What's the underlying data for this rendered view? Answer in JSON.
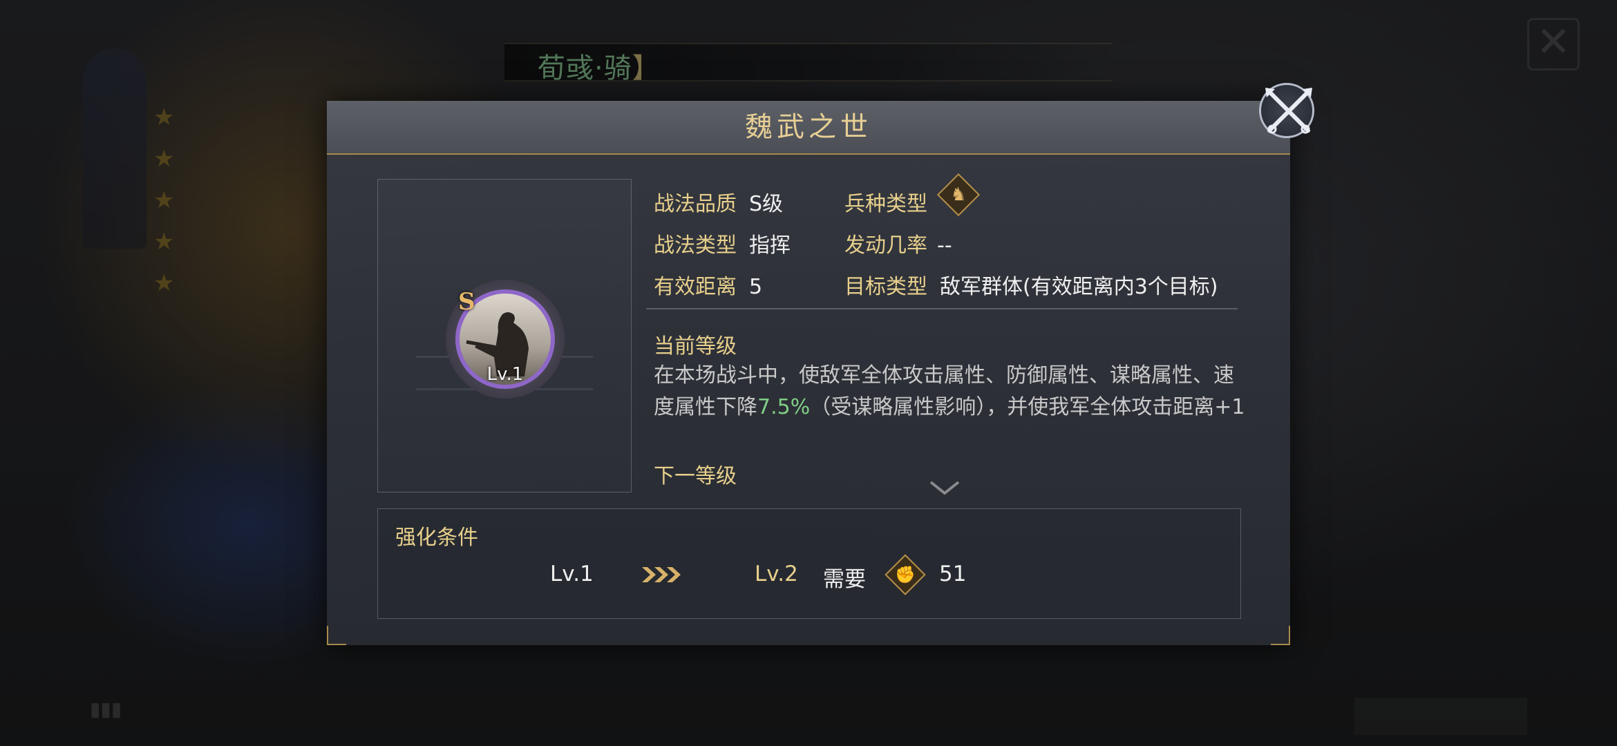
{
  "background": {
    "general_name": "荀彧·骑",
    "general_bracket": "】"
  },
  "dialog": {
    "title": "魏武之世",
    "close_icon": "crossed-swords-close-icon"
  },
  "skill": {
    "grade_badge": "S",
    "level_label": "Lv.1",
    "ring_color": "#8f67c8"
  },
  "attributes": {
    "quality_label": "战法品质",
    "quality_value": "S级",
    "unit_type_label": "兵种类型",
    "unit_type_icon": "cavalry-horse-icon",
    "type_label": "战法类型",
    "type_value": "指挥",
    "trigger_rate_label": "发动几率",
    "trigger_rate_value": "--",
    "range_label": "有效距离",
    "range_value": "5",
    "target_label": "目标类型",
    "target_value": "敌军群体(有效距离内3个目标)"
  },
  "current_level": {
    "label": "当前等级",
    "desc_part1": "在本场战斗中，使敌军全体攻击属性、防御属性、谋略属性、速度属性下降",
    "desc_highlight": "7.5%",
    "desc_part2": "（受谋略属性影响），并使我军全体攻击距离+1"
  },
  "next_level": {
    "label": "下一等级"
  },
  "enhance": {
    "title": "强化条件",
    "from_level": "Lv.1",
    "to_level": "Lv.2",
    "need_label": "需要",
    "resource_icon": "fist-icon",
    "need_value": "51"
  },
  "colors": {
    "gold_text": "#e8d08c",
    "highlight_green": "#7fcf86",
    "border_gold": "#a88a4c"
  }
}
